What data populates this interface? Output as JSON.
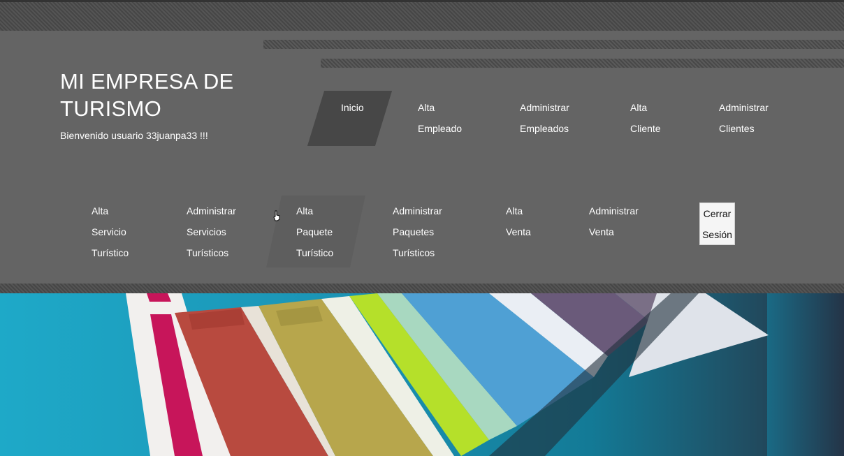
{
  "brand": {
    "title": "MI EMPRESA DE TURISMO",
    "welcome": "Bienvenido usuario 33juanpa33 !!!"
  },
  "nav": {
    "row1": [
      {
        "line1": "Inicio",
        "line2": "",
        "line3": ""
      },
      {
        "line1": "Alta",
        "line2": "Empleado",
        "line3": ""
      },
      {
        "line1": "Administrar",
        "line2": "Empleados",
        "line3": ""
      },
      {
        "line1": "Alta",
        "line2": "Cliente",
        "line3": ""
      },
      {
        "line1": "Administrar",
        "line2": "Clientes",
        "line3": ""
      }
    ],
    "row2": [
      {
        "line1": "Alta",
        "line2": "Servicio",
        "line3": "Turístico"
      },
      {
        "line1": "Administrar",
        "line2": "Servicios",
        "line3": "Turísticos"
      },
      {
        "line1": "Alta",
        "line2": "Paquete",
        "line3": "Turístico"
      },
      {
        "line1": "Administrar",
        "line2": "Paquetes",
        "line3": "Turísticos"
      },
      {
        "line1": "Alta",
        "line2": "Venta",
        "line3": ""
      },
      {
        "line1": "Administrar",
        "line2": "Venta",
        "line3": ""
      }
    ],
    "active_item": "Inicio",
    "logout": {
      "line1": "Cerrar",
      "line2": "Sesión"
    }
  },
  "hero": {
    "description": "color swatch fan",
    "colors": {
      "background": "#1b94b5",
      "magenta": "#c7155a",
      "red": "#b84a3f",
      "olive": "#b7a64c",
      "lime": "#b5e02a",
      "mint": "#a8d8c0",
      "blue": "#4fa0d4",
      "purple": "#6a5a7a"
    }
  },
  "colors": {
    "header_bg": "#646464",
    "active_item_bg": "#474747",
    "text": "#ffffff"
  }
}
